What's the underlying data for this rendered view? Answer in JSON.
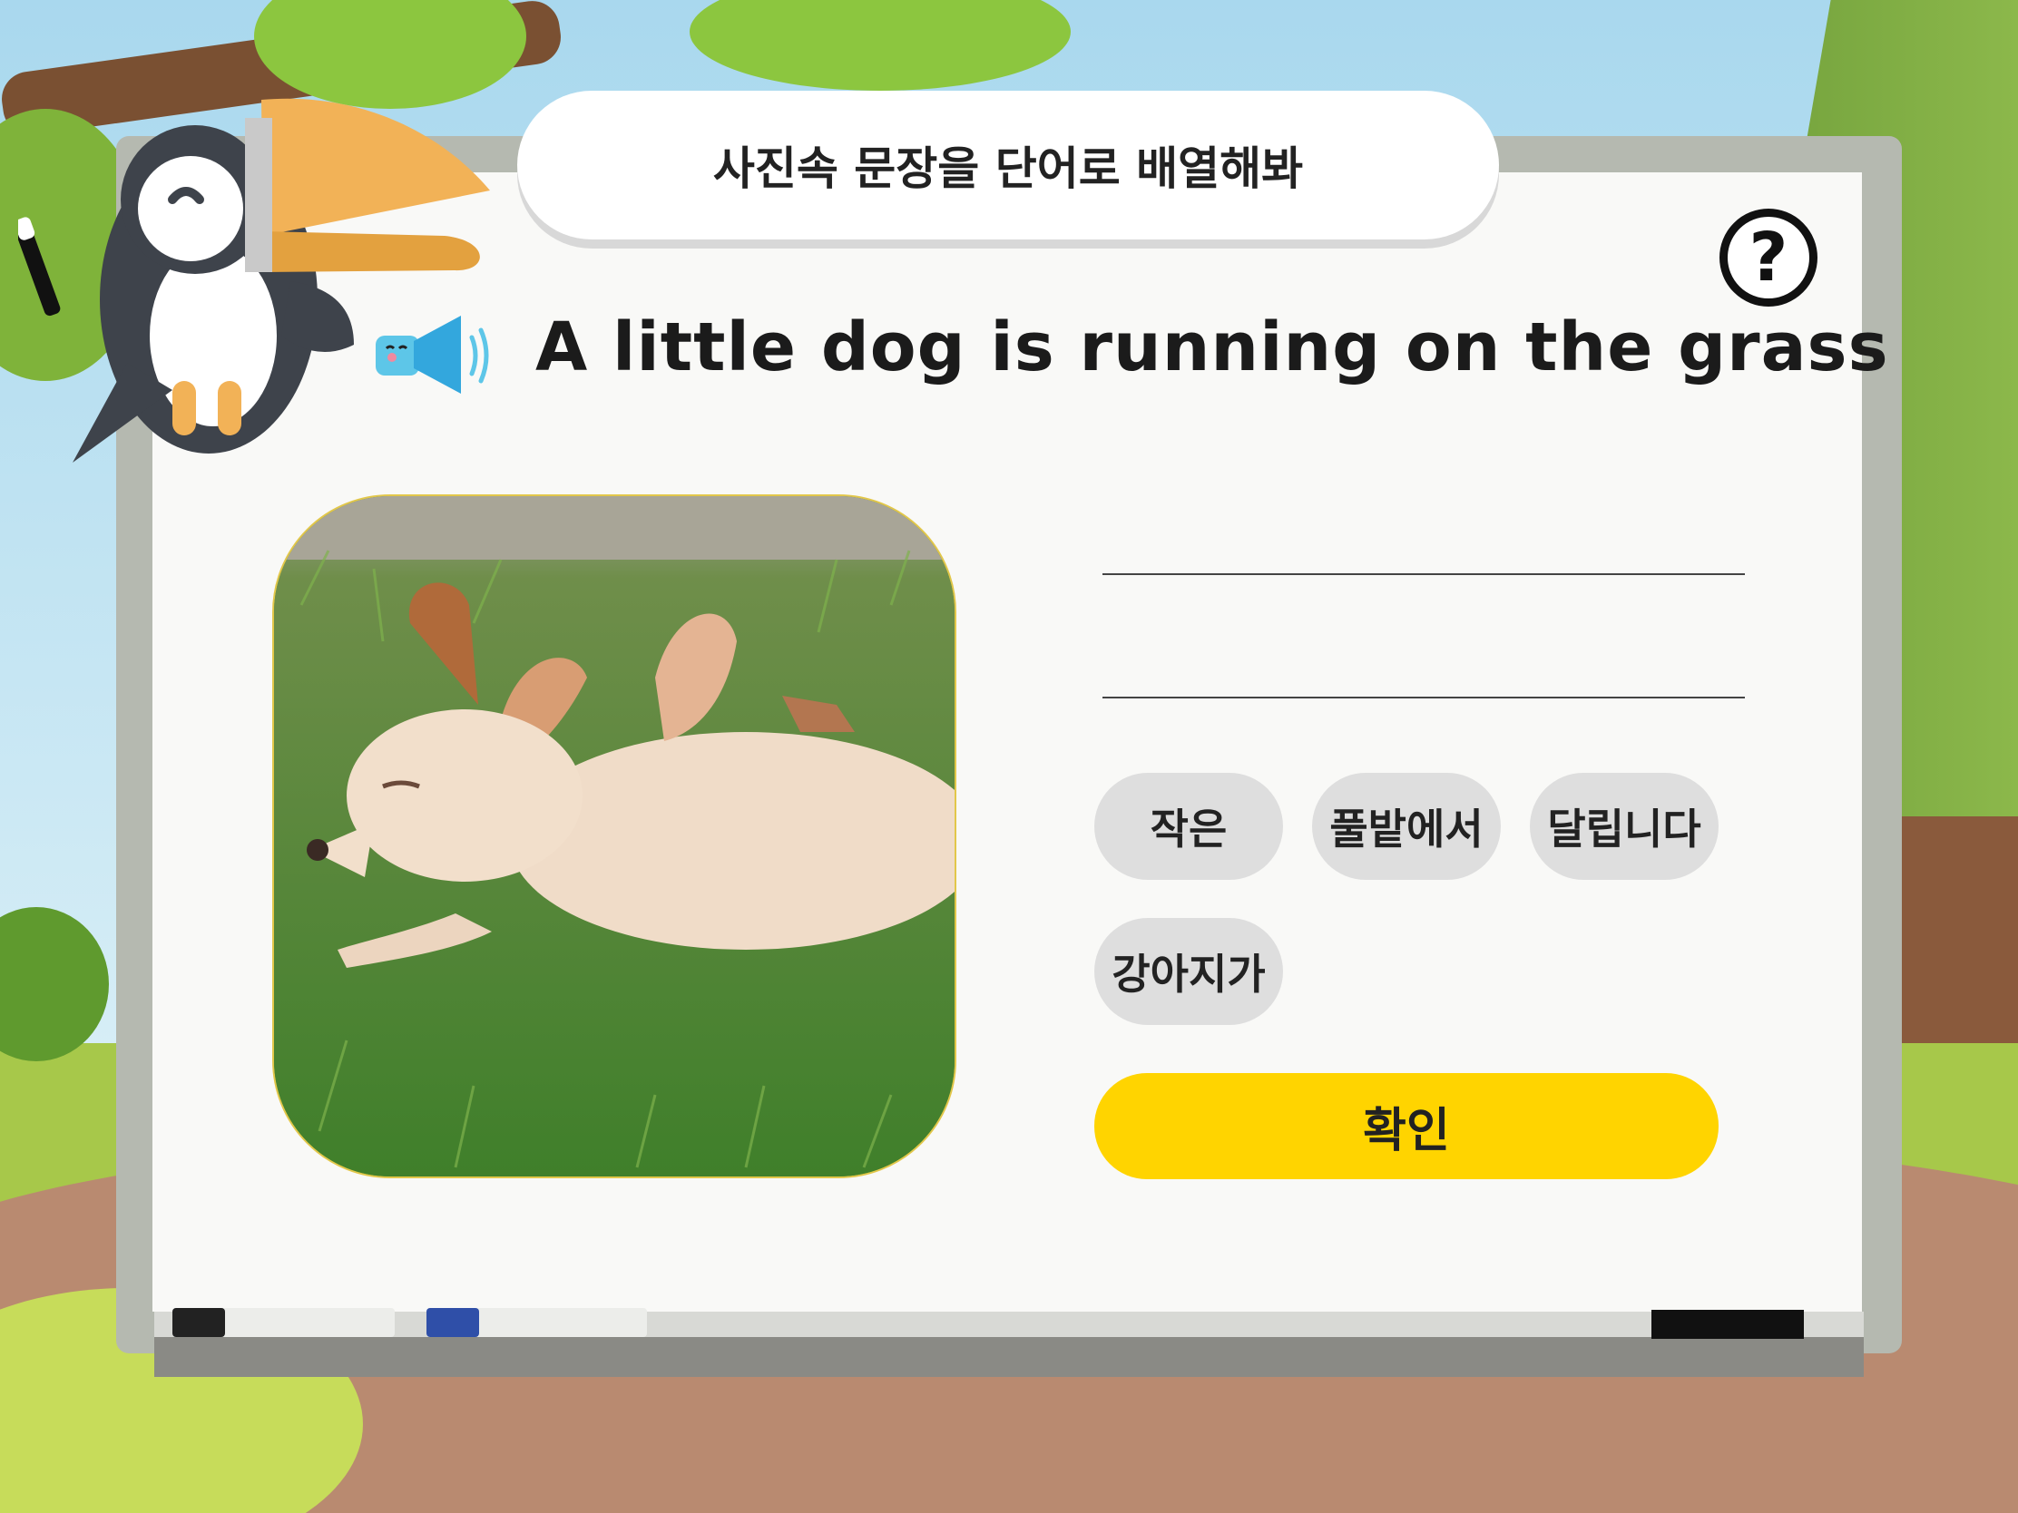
{
  "header": {
    "instruction": "사진속 문장을 단어로 배열해봐"
  },
  "help": {
    "icon": "question-circle-icon",
    "label": "?"
  },
  "prompt": {
    "sentence": "A little dog is running on the grass",
    "audio_icon": "speaker-icon"
  },
  "photo": {
    "subject": "dog-running-on-grass-photo"
  },
  "word_bank": [
    {
      "label": "작은"
    },
    {
      "label": "풀밭에서"
    },
    {
      "label": "달립니다"
    },
    {
      "label": "강아지가"
    }
  ],
  "confirm": {
    "label": "확인"
  },
  "colors": {
    "accent": "#ffd400",
    "chip": "#dedede",
    "board": "#f9f9f7",
    "frame": "#b5b9b0"
  }
}
